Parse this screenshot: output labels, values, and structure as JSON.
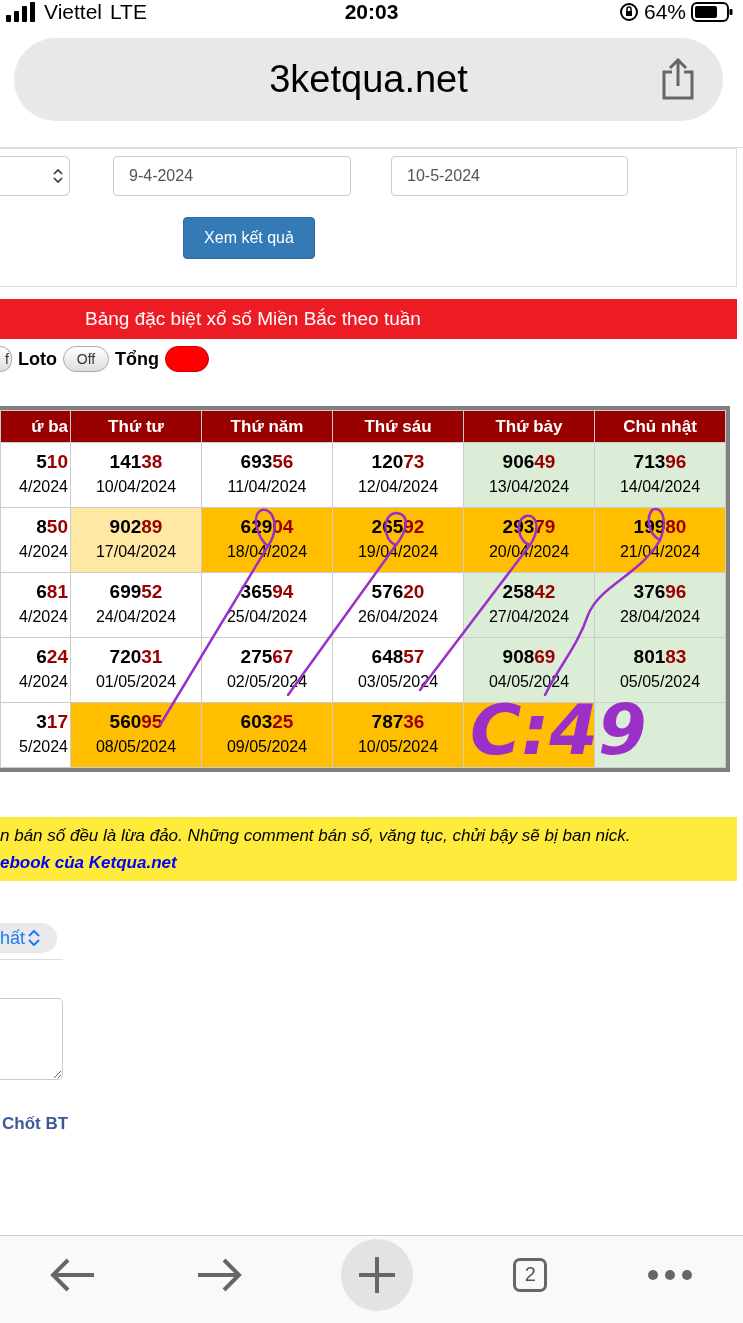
{
  "status_bar": {
    "carrier": "Viettel",
    "network": "LTE",
    "time": "20:03",
    "battery": "64%"
  },
  "address_bar": {
    "url": "3ketqua.net"
  },
  "filter": {
    "from_date": "9-4-2024",
    "to_date": "10-5-2024",
    "submit": "Xem kết quả"
  },
  "table_title": "Bảng đặc biệt xổ số Miền Bắc theo tuần",
  "toggles": [
    {
      "switch_text": "f",
      "on": false
    },
    {
      "label": "Loto",
      "switch_text": "Off",
      "on": false
    },
    {
      "label": "Tổng",
      "on": true
    }
  ],
  "table": {
    "columns": [
      "ứ ba",
      "Thứ tư",
      "Thứ năm",
      "Thứ sáu",
      "Thứ bảy",
      "Chủ nhật"
    ],
    "rows": [
      [
        {
          "head": "5",
          "tail": "10",
          "date": "4/2024",
          "color": "#ffffff"
        },
        {
          "head": "141",
          "tail": "38",
          "date": "10/04/2024",
          "color": "#ffffff"
        },
        {
          "head": "693",
          "tail": "56",
          "date": "11/04/2024",
          "color": "#ffffff"
        },
        {
          "head": "120",
          "tail": "73",
          "date": "12/04/2024",
          "color": "#ffffff"
        },
        {
          "head": "906",
          "tail": "49",
          "date": "13/04/2024",
          "color": "#dcedd7"
        },
        {
          "head": "713",
          "tail": "96",
          "date": "14/04/2024",
          "color": "#dcedd7"
        }
      ],
      [
        {
          "head": "8",
          "tail": "50",
          "date": "4/2024",
          "color": "#ffffff"
        },
        {
          "head": "902",
          "tail": "89",
          "date": "17/04/2024",
          "color": "#ffe8a3"
        },
        {
          "head": "629",
          "tail": "04",
          "date": "18/04/2024",
          "color": "#ffbf00"
        },
        {
          "head": "265",
          "tail": "92",
          "date": "19/04/2024",
          "color": "#ffbf00"
        },
        {
          "head": "293",
          "tail": "79",
          "date": "20/04/2024",
          "color": "#ffbf00"
        },
        {
          "head": "199",
          "tail": "80",
          "date": "21/04/2024",
          "color": "#ffbf00"
        }
      ],
      [
        {
          "head": "6",
          "tail": "81",
          "date": "4/2024",
          "color": "#ffffff"
        },
        {
          "head": "699",
          "tail": "52",
          "date": "24/04/2024",
          "color": "#ffffff"
        },
        {
          "head": "365",
          "tail": "94",
          "date": "25/04/2024",
          "color": "#ffffff"
        },
        {
          "head": "576",
          "tail": "20",
          "date": "26/04/2024",
          "color": "#ffffff"
        },
        {
          "head": "258",
          "tail": "42",
          "date": "27/04/2024",
          "color": "#dcedd7"
        },
        {
          "head": "376",
          "tail": "96",
          "date": "28/04/2024",
          "color": "#dcedd7"
        }
      ],
      [
        {
          "head": "6",
          "tail": "24",
          "date": "4/2024",
          "color": "#ffffff"
        },
        {
          "head": "720",
          "tail": "31",
          "date": "01/05/2024",
          "color": "#ffffff"
        },
        {
          "head": "275",
          "tail": "67",
          "date": "02/05/2024",
          "color": "#ffffff"
        },
        {
          "head": "648",
          "tail": "57",
          "date": "03/05/2024",
          "color": "#ffffff"
        },
        {
          "head": "908",
          "tail": "69",
          "date": "04/05/2024",
          "color": "#dcedd7"
        },
        {
          "head": "801",
          "tail": "83",
          "date": "05/05/2024",
          "color": "#dcedd7"
        }
      ],
      [
        {
          "head": "3",
          "tail": "17",
          "date": "5/2024",
          "color": "#ffffff"
        },
        {
          "head": "560",
          "tail": "95",
          "date": "08/05/2024",
          "color": "#ffbf00"
        },
        {
          "head": "603",
          "tail": "25",
          "date": "09/05/2024",
          "color": "#ffbf00"
        },
        {
          "head": "787",
          "tail": "36",
          "date": "10/05/2024",
          "color": "#ffbf00"
        },
        {
          "color": "#ffbf00"
        },
        {
          "color": "#dcedd7"
        }
      ]
    ]
  },
  "handwritten_note": "C:49",
  "notice": {
    "text": "n bán số đều là lừa đảo. Những comment bán số, văng tục, chửi bậy sẽ bị ban nick.",
    "link": "ebook của Ketqua.net"
  },
  "sort_select": {
    "value": "hất"
  },
  "post_link": "Chốt BT",
  "toolbar": {
    "tab_count": "2"
  }
}
